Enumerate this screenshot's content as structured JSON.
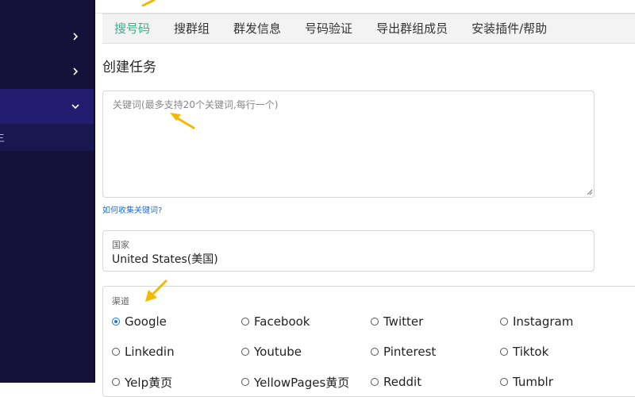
{
  "sidebar": {
    "chevrons": [
      "chevron-right",
      "chevron-right",
      "chevron-down"
    ],
    "sub_item_label": "三"
  },
  "tabs": [
    {
      "label": "搜号码",
      "active": true
    },
    {
      "label": "搜群组",
      "active": false
    },
    {
      "label": "群发信息",
      "active": false
    },
    {
      "label": "号码验证",
      "active": false
    },
    {
      "label": "导出群组成员",
      "active": false
    },
    {
      "label": "安装插件/帮助",
      "active": false
    }
  ],
  "page_title": "创建任务",
  "keywords": {
    "placeholder": "关键词(最多支持20个关键词,每行一个)",
    "value": ""
  },
  "help_link": "如何收集关键词?",
  "country": {
    "label": "国家",
    "value": "United States(美国)"
  },
  "channel": {
    "label": "渠道",
    "options": [
      {
        "label": "Google",
        "checked": true
      },
      {
        "label": "Facebook",
        "checked": false
      },
      {
        "label": "Twitter",
        "checked": false
      },
      {
        "label": "Instagram",
        "checked": false
      },
      {
        "label": "Linkedin",
        "checked": false
      },
      {
        "label": "Youtube",
        "checked": false
      },
      {
        "label": "Pinterest",
        "checked": false
      },
      {
        "label": "Tiktok",
        "checked": false
      },
      {
        "label": "Yelp黄页",
        "checked": false
      },
      {
        "label": "YellowPages黄页",
        "checked": false
      },
      {
        "label": "Reddit",
        "checked": false
      },
      {
        "label": "Tumblr",
        "checked": false
      }
    ]
  },
  "colors": {
    "sidebar_bg": "#15123a",
    "sidebar_active": "#221c6e",
    "tab_active": "#35b08a",
    "link": "#1e6fd0",
    "radio_checked": "#1a73e8",
    "annotation_arrow": "#f5b800"
  }
}
